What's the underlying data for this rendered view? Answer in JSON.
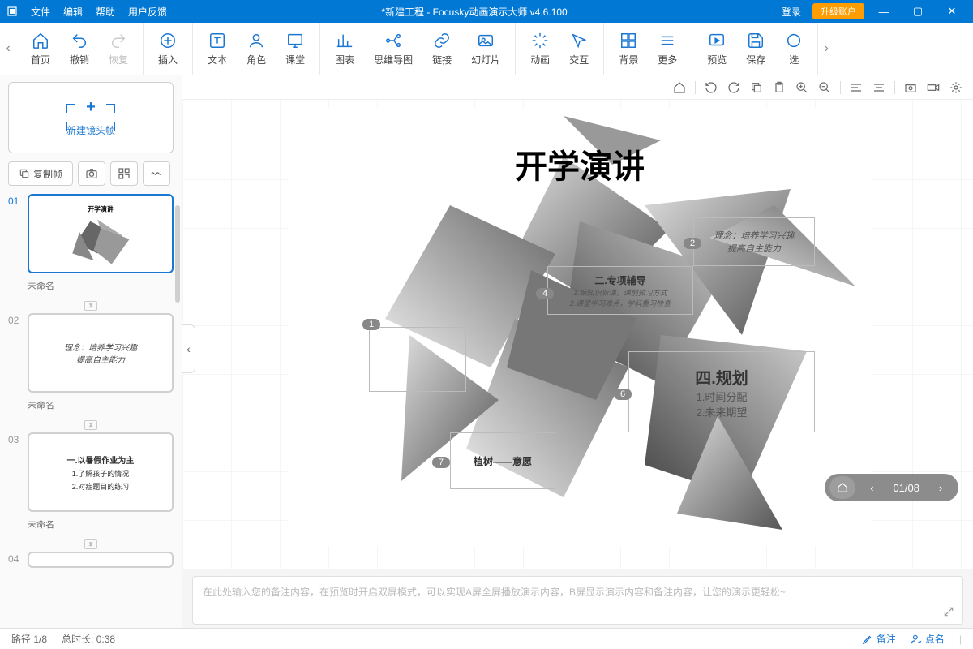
{
  "titlebar": {
    "menus": [
      "文件",
      "编辑",
      "帮助",
      "用户反馈"
    ],
    "title": "*新建工程 - Focusky动画演示大师  v4.6.100",
    "login": "登录",
    "upgrade": "升级账户"
  },
  "toolbar": {
    "nav_prev": "‹",
    "nav_next": "›",
    "groups": [
      [
        {
          "id": "home",
          "label": "首页"
        },
        {
          "id": "undo",
          "label": "撤销"
        },
        {
          "id": "redo",
          "label": "恢复",
          "disabled": true
        }
      ],
      [
        {
          "id": "insert",
          "label": "插入"
        }
      ],
      [
        {
          "id": "text",
          "label": "文本"
        },
        {
          "id": "role",
          "label": "角色"
        },
        {
          "id": "class",
          "label": "课堂"
        }
      ],
      [
        {
          "id": "chart",
          "label": "图表"
        },
        {
          "id": "mindmap",
          "label": "思维导图"
        },
        {
          "id": "link",
          "label": "链接"
        },
        {
          "id": "slide",
          "label": "幻灯片"
        }
      ],
      [
        {
          "id": "anim",
          "label": "动画"
        },
        {
          "id": "interact",
          "label": "交互"
        }
      ],
      [
        {
          "id": "bg",
          "label": "背景"
        },
        {
          "id": "more",
          "label": "更多"
        }
      ],
      [
        {
          "id": "preview",
          "label": "预览"
        },
        {
          "id": "save",
          "label": "保存"
        },
        {
          "id": "select",
          "label": "选"
        }
      ]
    ]
  },
  "sidepanel": {
    "new_frame": "新建镜头帧",
    "copy_frame": "复制帧",
    "thumbs": [
      {
        "num": "01",
        "title": "未命名",
        "active": true
      },
      {
        "num": "02",
        "title": "未命名"
      },
      {
        "num": "03",
        "title": "未命名"
      },
      {
        "num": "04",
        "title": ""
      }
    ],
    "th2_line1": "理念：培养学习兴趣",
    "th2_line2": "提高自主能力",
    "th3_line1": "一.以暑假作业为主",
    "th3_line2": "1.了解孩子的情况",
    "th3_line3": "2.对症题目的练习"
  },
  "canvas": {
    "title": "开学演讲",
    "tags": {
      "t1": "1",
      "t2": "2",
      "t4": "4",
      "t6": "6",
      "t7": "7"
    },
    "sec2_l1": "理念：培养学习兴趣",
    "sec2_l2": "提高自主能力",
    "sec4_t": "二.专项辅导",
    "sec4_l1": "1.新知识新课，课前预习方式",
    "sec4_l2": "2.课堂学习难点，学科重习检查",
    "sec6_t": "四.规划",
    "sec6_l1": "1.时间分配",
    "sec6_l2": "2.未来期望",
    "sec7_t": "植树——意愿"
  },
  "notes": {
    "placeholder": "在此处输入您的备注内容，在预览时开启双屏模式，可以实现A屏全屏播放演示内容，B屏显示演示内容和备注内容，让您的演示更轻松~"
  },
  "navpill": {
    "page": "01/08"
  },
  "status": {
    "path_label": "路径 1/8",
    "duration_label": "总时长: 0:38",
    "notes": "备注",
    "roll": "点名"
  }
}
